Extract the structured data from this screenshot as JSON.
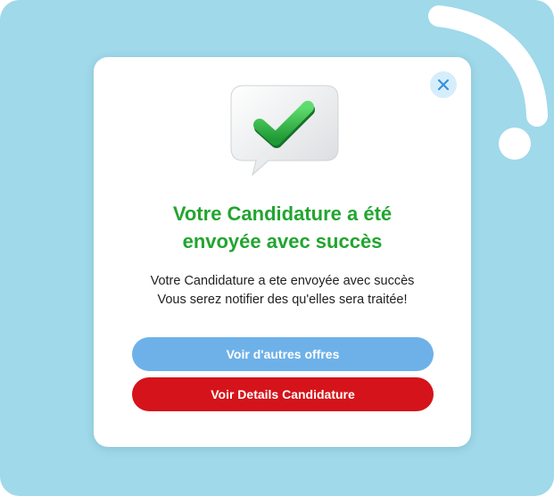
{
  "dialog": {
    "title": "Votre Candidature a été\nenvoyée avec succès",
    "message": "Votre Candidature a ete envoyée avec succès\nVous serez notifier des qu'elles sera traitée!",
    "close_icon": "close-icon",
    "hero_icon": "checkmark-speech-bubble-icon"
  },
  "actions": {
    "primary_label": "Voir d'autres offres",
    "secondary_label": "Voir Details Candidature"
  },
  "colors": {
    "background": "#9fd9ea",
    "title": "#22a52f",
    "primary_button": "#6eb1e9",
    "secondary_button": "#d5131a"
  }
}
